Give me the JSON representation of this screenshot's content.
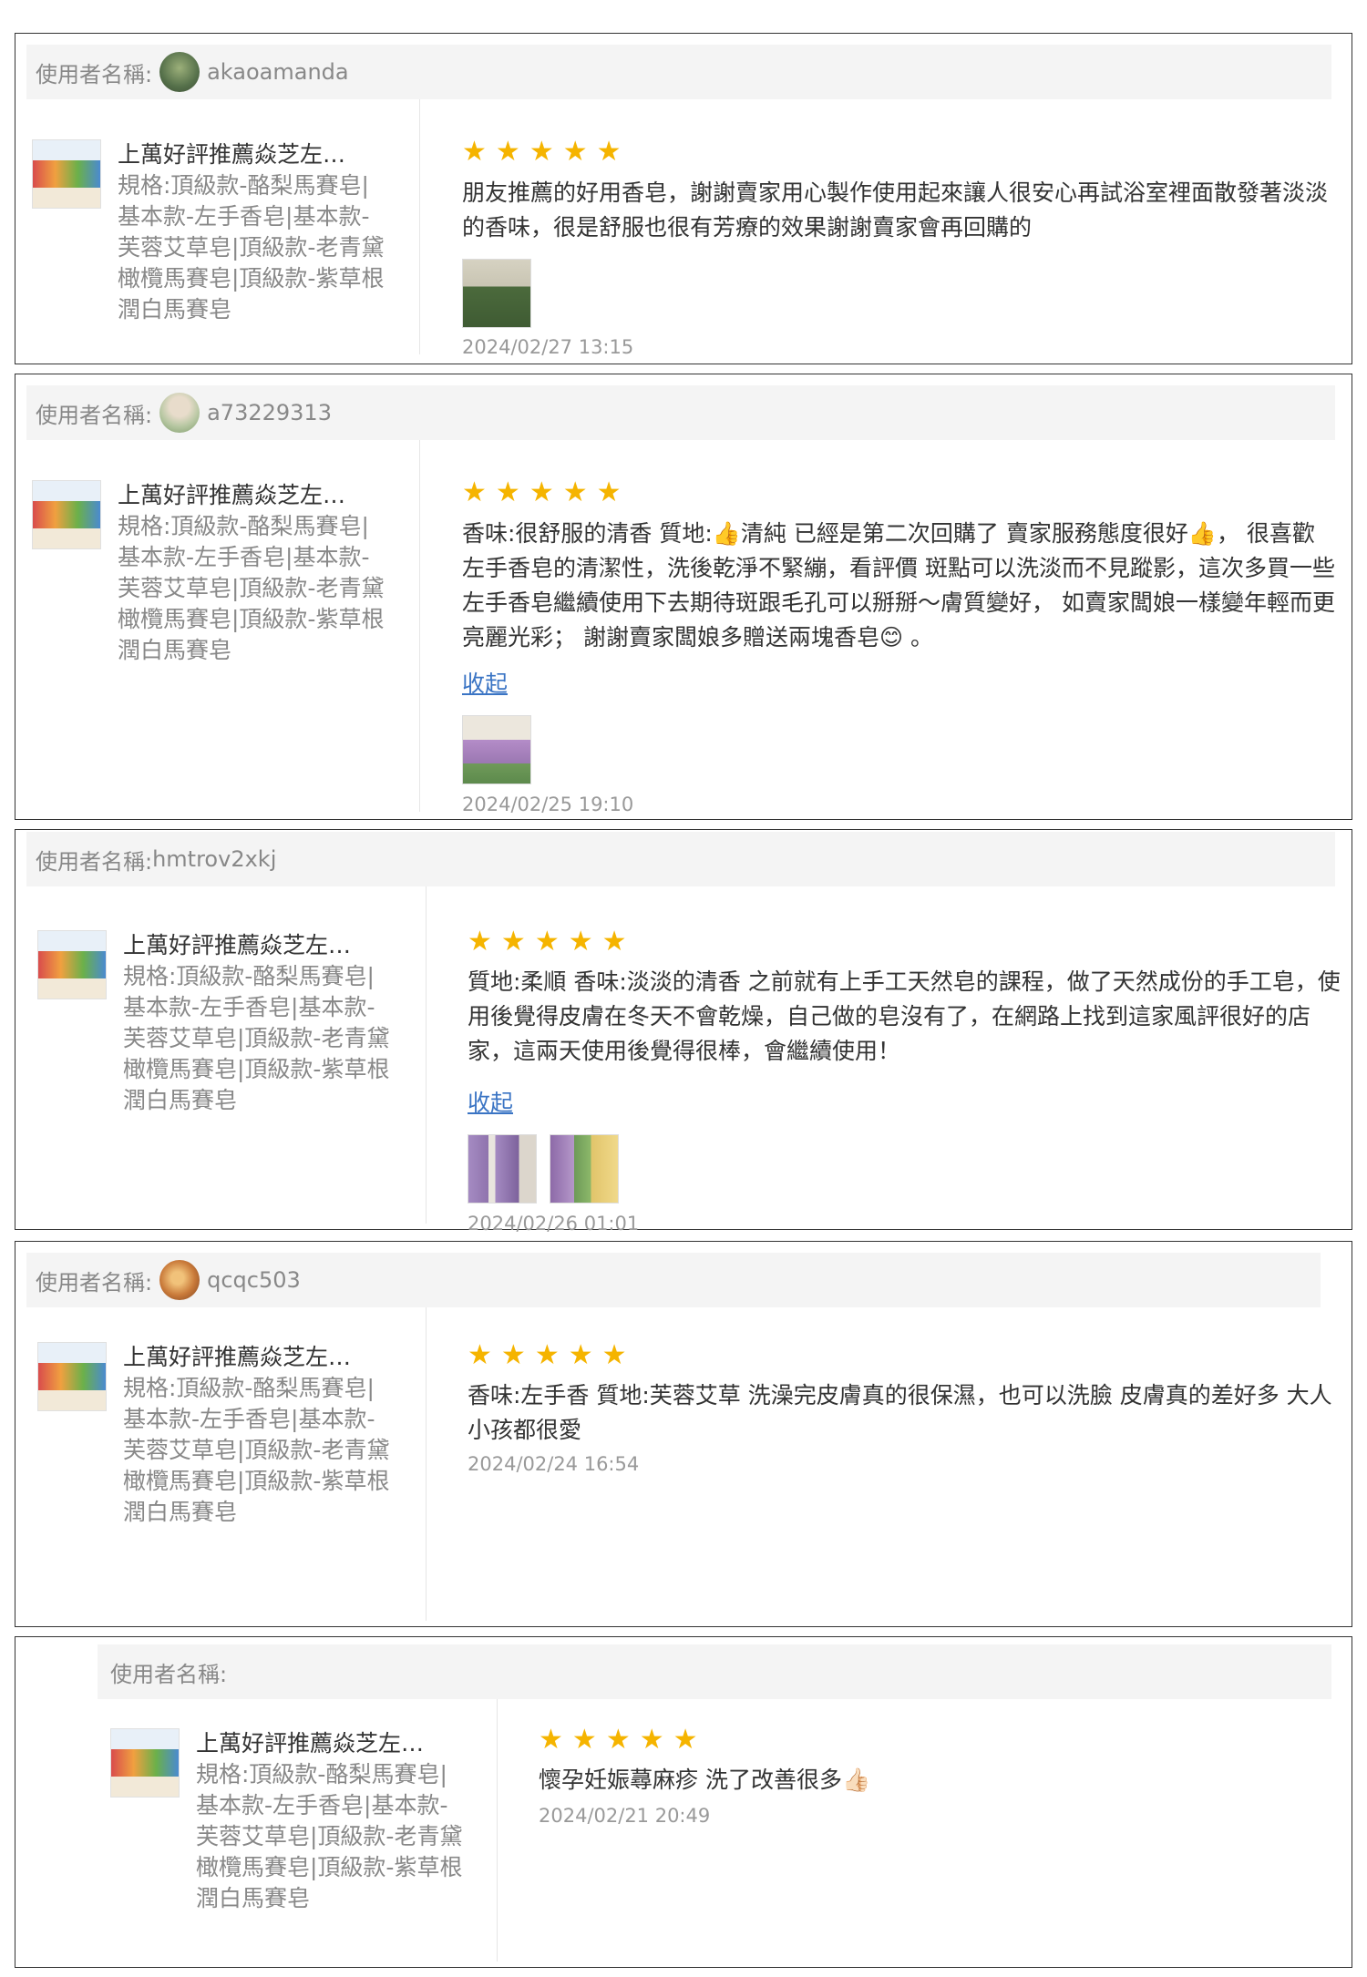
{
  "label_username": "使用者名稱:",
  "collapse_label": "收起",
  "reviews": [
    {
      "username": "akaoamanda",
      "product_name": "上萬好評推薦焱芝左…",
      "product_spec": "規格:頂級款-酪梨馬賽皂|基本款-左手香皂|基本款-芙蓉艾草皂|頂級款-老青黛橄欖馬賽皂|頂級款-紫草根潤白馬賽皂",
      "rating": 5,
      "text": "朋友推薦的好用香皂，謝謝賣家用心製作使用起來讓人很安心再試浴室裡面散發著淡淡的香味，很是舒服也很有芳療的效果謝謝賣家會再回購的",
      "date": "2024/02/27 13:15"
    },
    {
      "username": "a73229313",
      "product_name": "上萬好評推薦焱芝左…",
      "product_spec": "規格:頂級款-酪梨馬賽皂|基本款-左手香皂|基本款-芙蓉艾草皂|頂級款-老青黛橄欖馬賽皂|頂級款-紫草根潤白馬賽皂",
      "rating": 5,
      "text": "香味:很舒服的清香 質地:👍清純 已經是第二次回購了 賣家服務態度很好👍， 很喜歡左手香皂的清潔性，洗後乾淨不緊繃，看評價 斑點可以洗淡而不見蹤影，這次多買一些左手香皂繼續使用下去期待斑跟毛孔可以掰掰～膚質變好， 如賣家闆娘一樣變年輕而更亮麗光彩； 謝謝賣家闆娘多贈送兩塊香皂😊 。",
      "date": "2024/02/25 19:10"
    },
    {
      "username": "hmtrov2xkj",
      "product_name": "上萬好評推薦焱芝左…",
      "product_spec": "規格:頂級款-酪梨馬賽皂|基本款-左手香皂|基本款-芙蓉艾草皂|頂級款-老青黛橄欖馬賽皂|頂級款-紫草根潤白馬賽皂",
      "rating": 5,
      "text": "質地:柔順 香味:淡淡的清香 之前就有上手工天然皂的課程，做了天然成份的手工皂，使用後覺得皮膚在冬天不會乾燥，自己做的皂沒有了，在網路上找到這家風評很好的店家，這兩天使用後覺得很棒，會繼續使用！",
      "date": "2024/02/26 01:01"
    },
    {
      "username": "qcqc503",
      "product_name": "上萬好評推薦焱芝左…",
      "product_spec": "規格:頂級款-酪梨馬賽皂|基本款-左手香皂|基本款-芙蓉艾草皂|頂級款-老青黛橄欖馬賽皂|頂級款-紫草根潤白馬賽皂",
      "rating": 5,
      "text": "香味:左手香 質地:芙蓉艾草 洗澡完皮膚真的很保濕，也可以洗臉 皮膚真的差好多 大人小孩都很愛",
      "date": "2024/02/24 16:54"
    },
    {
      "username": "",
      "product_name": "上萬好評推薦焱芝左…",
      "product_spec": "規格:頂級款-酪梨馬賽皂|基本款-左手香皂|基本款-芙蓉艾草皂|頂級款-老青黛橄欖馬賽皂|頂級款-紫草根潤白馬賽皂",
      "rating": 5,
      "text": "懷孕妊娠蕁麻疹 洗了改善很多👍🏻",
      "date": "2024/02/21 20:49"
    }
  ]
}
